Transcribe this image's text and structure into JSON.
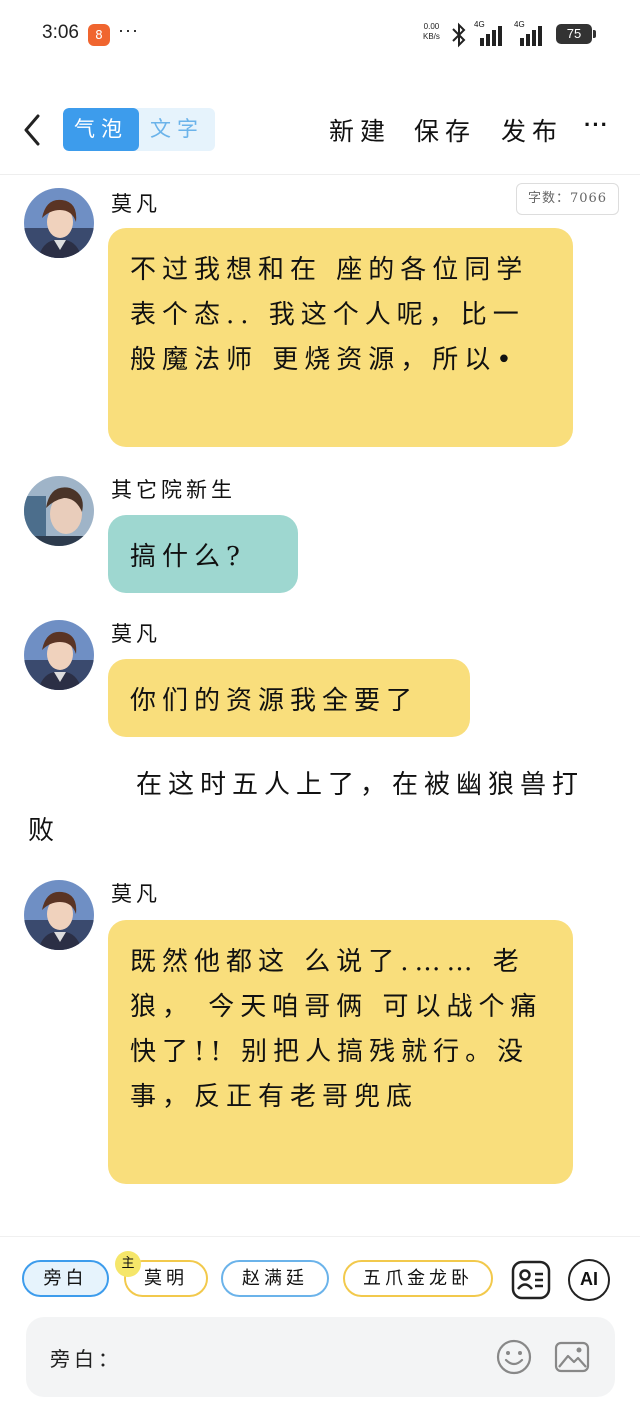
{
  "status_bar": {
    "time": "3:06",
    "app_badge": "8",
    "more_dots": "···",
    "net_speed_value": "0.00",
    "net_speed_unit": "KB/s",
    "signal1_label": "4G",
    "signal2_label": "4G",
    "battery": "75"
  },
  "header": {
    "mode_bubble": "气泡",
    "mode_text": "文字",
    "new_label": "新建",
    "save_label": "保存",
    "publish_label": "发布",
    "more_label": "···"
  },
  "word_count": "字数：7066",
  "messages": [
    {
      "speaker": "莫凡",
      "text": "不过我想和在  座的各位同学  表个态.. 我这个人呢，比一般魔法师  更烧资源，所以•",
      "color": "#f9de7c"
    },
    {
      "speaker": "其它院新生",
      "text": "搞什么?",
      "color": "#9ed7d0"
    },
    {
      "speaker": "莫凡",
      "text": "你们的资源我全要了",
      "color": "#f9de7c"
    }
  ],
  "narration": "在这时五人上了，在被幽狼兽打败",
  "messages2": [
    {
      "speaker": "莫凡",
      "text": "既然他都这  么说了.…… 老狼，  今天咱哥俩  可以战个痛  快了!! 别把人搞残就行。没事，反正有老哥兜底",
      "color": "#f9de7c"
    }
  ],
  "characters": {
    "aside": "旁白",
    "main_badge": "主",
    "moming": "莫明",
    "zhao": "赵满廷",
    "wuzhua": "五爪金龙卧"
  },
  "input": {
    "label": "旁白："
  },
  "ai_label": "AI"
}
